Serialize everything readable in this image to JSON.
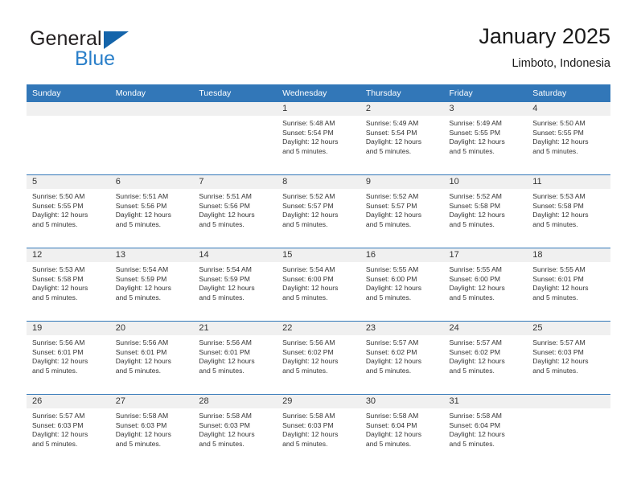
{
  "brand": {
    "name_top": "General",
    "name_bottom": "Blue",
    "accent_color": "#2a7fc9",
    "triangle_color": "#1464aa",
    "triangle_icon": "triangle-icon"
  },
  "header": {
    "title": "January 2025",
    "subtitle": "Limboto, Indonesia"
  },
  "theme": {
    "header_bg": "#3277b8",
    "daynum_bg": "#f0f0f0",
    "row_rule": "#3277b8",
    "text": "#333333"
  },
  "calendar": {
    "weekday_headers": [
      "Sunday",
      "Monday",
      "Tuesday",
      "Wednesday",
      "Thursday",
      "Friday",
      "Saturday"
    ],
    "weeks": [
      [
        {
          "day": "",
          "sunrise": "",
          "sunset": "",
          "daylight_line1": "",
          "daylight_line2": ""
        },
        {
          "day": "",
          "sunrise": "",
          "sunset": "",
          "daylight_line1": "",
          "daylight_line2": ""
        },
        {
          "day": "",
          "sunrise": "",
          "sunset": "",
          "daylight_line1": "",
          "daylight_line2": ""
        },
        {
          "day": "1",
          "sunrise": "Sunrise: 5:48 AM",
          "sunset": "Sunset: 5:54 PM",
          "daylight_line1": "Daylight: 12 hours",
          "daylight_line2": "and 5 minutes."
        },
        {
          "day": "2",
          "sunrise": "Sunrise: 5:49 AM",
          "sunset": "Sunset: 5:54 PM",
          "daylight_line1": "Daylight: 12 hours",
          "daylight_line2": "and 5 minutes."
        },
        {
          "day": "3",
          "sunrise": "Sunrise: 5:49 AM",
          "sunset": "Sunset: 5:55 PM",
          "daylight_line1": "Daylight: 12 hours",
          "daylight_line2": "and 5 minutes."
        },
        {
          "day": "4",
          "sunrise": "Sunrise: 5:50 AM",
          "sunset": "Sunset: 5:55 PM",
          "daylight_line1": "Daylight: 12 hours",
          "daylight_line2": "and 5 minutes."
        }
      ],
      [
        {
          "day": "5",
          "sunrise": "Sunrise: 5:50 AM",
          "sunset": "Sunset: 5:55 PM",
          "daylight_line1": "Daylight: 12 hours",
          "daylight_line2": "and 5 minutes."
        },
        {
          "day": "6",
          "sunrise": "Sunrise: 5:51 AM",
          "sunset": "Sunset: 5:56 PM",
          "daylight_line1": "Daylight: 12 hours",
          "daylight_line2": "and 5 minutes."
        },
        {
          "day": "7",
          "sunrise": "Sunrise: 5:51 AM",
          "sunset": "Sunset: 5:56 PM",
          "daylight_line1": "Daylight: 12 hours",
          "daylight_line2": "and 5 minutes."
        },
        {
          "day": "8",
          "sunrise": "Sunrise: 5:52 AM",
          "sunset": "Sunset: 5:57 PM",
          "daylight_line1": "Daylight: 12 hours",
          "daylight_line2": "and 5 minutes."
        },
        {
          "day": "9",
          "sunrise": "Sunrise: 5:52 AM",
          "sunset": "Sunset: 5:57 PM",
          "daylight_line1": "Daylight: 12 hours",
          "daylight_line2": "and 5 minutes."
        },
        {
          "day": "10",
          "sunrise": "Sunrise: 5:52 AM",
          "sunset": "Sunset: 5:58 PM",
          "daylight_line1": "Daylight: 12 hours",
          "daylight_line2": "and 5 minutes."
        },
        {
          "day": "11",
          "sunrise": "Sunrise: 5:53 AM",
          "sunset": "Sunset: 5:58 PM",
          "daylight_line1": "Daylight: 12 hours",
          "daylight_line2": "and 5 minutes."
        }
      ],
      [
        {
          "day": "12",
          "sunrise": "Sunrise: 5:53 AM",
          "sunset": "Sunset: 5:58 PM",
          "daylight_line1": "Daylight: 12 hours",
          "daylight_line2": "and 5 minutes."
        },
        {
          "day": "13",
          "sunrise": "Sunrise: 5:54 AM",
          "sunset": "Sunset: 5:59 PM",
          "daylight_line1": "Daylight: 12 hours",
          "daylight_line2": "and 5 minutes."
        },
        {
          "day": "14",
          "sunrise": "Sunrise: 5:54 AM",
          "sunset": "Sunset: 5:59 PM",
          "daylight_line1": "Daylight: 12 hours",
          "daylight_line2": "and 5 minutes."
        },
        {
          "day": "15",
          "sunrise": "Sunrise: 5:54 AM",
          "sunset": "Sunset: 6:00 PM",
          "daylight_line1": "Daylight: 12 hours",
          "daylight_line2": "and 5 minutes."
        },
        {
          "day": "16",
          "sunrise": "Sunrise: 5:55 AM",
          "sunset": "Sunset: 6:00 PM",
          "daylight_line1": "Daylight: 12 hours",
          "daylight_line2": "and 5 minutes."
        },
        {
          "day": "17",
          "sunrise": "Sunrise: 5:55 AM",
          "sunset": "Sunset: 6:00 PM",
          "daylight_line1": "Daylight: 12 hours",
          "daylight_line2": "and 5 minutes."
        },
        {
          "day": "18",
          "sunrise": "Sunrise: 5:55 AM",
          "sunset": "Sunset: 6:01 PM",
          "daylight_line1": "Daylight: 12 hours",
          "daylight_line2": "and 5 minutes."
        }
      ],
      [
        {
          "day": "19",
          "sunrise": "Sunrise: 5:56 AM",
          "sunset": "Sunset: 6:01 PM",
          "daylight_line1": "Daylight: 12 hours",
          "daylight_line2": "and 5 minutes."
        },
        {
          "day": "20",
          "sunrise": "Sunrise: 5:56 AM",
          "sunset": "Sunset: 6:01 PM",
          "daylight_line1": "Daylight: 12 hours",
          "daylight_line2": "and 5 minutes."
        },
        {
          "day": "21",
          "sunrise": "Sunrise: 5:56 AM",
          "sunset": "Sunset: 6:01 PM",
          "daylight_line1": "Daylight: 12 hours",
          "daylight_line2": "and 5 minutes."
        },
        {
          "day": "22",
          "sunrise": "Sunrise: 5:56 AM",
          "sunset": "Sunset: 6:02 PM",
          "daylight_line1": "Daylight: 12 hours",
          "daylight_line2": "and 5 minutes."
        },
        {
          "day": "23",
          "sunrise": "Sunrise: 5:57 AM",
          "sunset": "Sunset: 6:02 PM",
          "daylight_line1": "Daylight: 12 hours",
          "daylight_line2": "and 5 minutes."
        },
        {
          "day": "24",
          "sunrise": "Sunrise: 5:57 AM",
          "sunset": "Sunset: 6:02 PM",
          "daylight_line1": "Daylight: 12 hours",
          "daylight_line2": "and 5 minutes."
        },
        {
          "day": "25",
          "sunrise": "Sunrise: 5:57 AM",
          "sunset": "Sunset: 6:03 PM",
          "daylight_line1": "Daylight: 12 hours",
          "daylight_line2": "and 5 minutes."
        }
      ],
      [
        {
          "day": "26",
          "sunrise": "Sunrise: 5:57 AM",
          "sunset": "Sunset: 6:03 PM",
          "daylight_line1": "Daylight: 12 hours",
          "daylight_line2": "and 5 minutes."
        },
        {
          "day": "27",
          "sunrise": "Sunrise: 5:58 AM",
          "sunset": "Sunset: 6:03 PM",
          "daylight_line1": "Daylight: 12 hours",
          "daylight_line2": "and 5 minutes."
        },
        {
          "day": "28",
          "sunrise": "Sunrise: 5:58 AM",
          "sunset": "Sunset: 6:03 PM",
          "daylight_line1": "Daylight: 12 hours",
          "daylight_line2": "and 5 minutes."
        },
        {
          "day": "29",
          "sunrise": "Sunrise: 5:58 AM",
          "sunset": "Sunset: 6:03 PM",
          "daylight_line1": "Daylight: 12 hours",
          "daylight_line2": "and 5 minutes."
        },
        {
          "day": "30",
          "sunrise": "Sunrise: 5:58 AM",
          "sunset": "Sunset: 6:04 PM",
          "daylight_line1": "Daylight: 12 hours",
          "daylight_line2": "and 5 minutes."
        },
        {
          "day": "31",
          "sunrise": "Sunrise: 5:58 AM",
          "sunset": "Sunset: 6:04 PM",
          "daylight_line1": "Daylight: 12 hours",
          "daylight_line2": "and 5 minutes."
        },
        {
          "day": "",
          "sunrise": "",
          "sunset": "",
          "daylight_line1": "",
          "daylight_line2": ""
        }
      ]
    ]
  }
}
